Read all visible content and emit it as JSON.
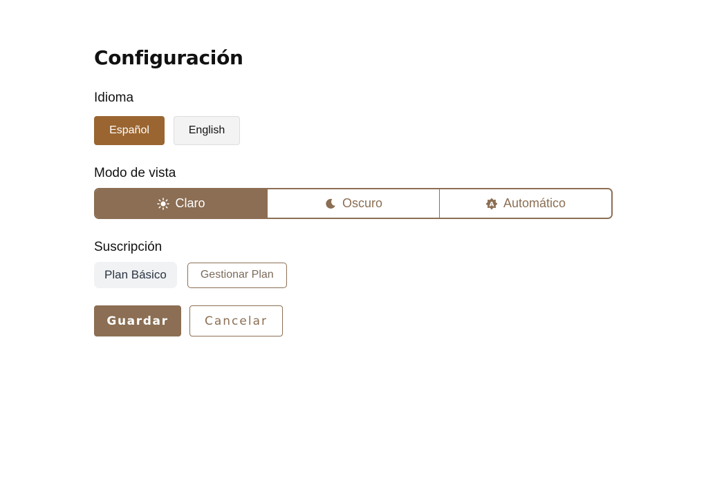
{
  "page": {
    "title": "Configuración"
  },
  "language": {
    "label": "Idioma",
    "options": [
      {
        "label": "Español",
        "selected": true
      },
      {
        "label": "English",
        "selected": false
      }
    ]
  },
  "view_mode": {
    "label": "Modo de vista",
    "options": [
      {
        "label": "Claro",
        "icon": "sun-icon",
        "selected": true
      },
      {
        "label": "Oscuro",
        "icon": "moon-icon",
        "selected": false
      },
      {
        "label": "Automático",
        "icon": "auto-brightness-icon",
        "selected": false
      }
    ]
  },
  "subscription": {
    "label": "Suscripción",
    "plan": "Plan Básico",
    "manage_label": "Gestionar Plan"
  },
  "actions": {
    "save_label": "Guardar",
    "cancel_label": "Cancelar"
  },
  "colors": {
    "accent": "#8b6e53",
    "language_selected": "#9a6530",
    "plan_chip_bg": "#f1f2f4"
  }
}
